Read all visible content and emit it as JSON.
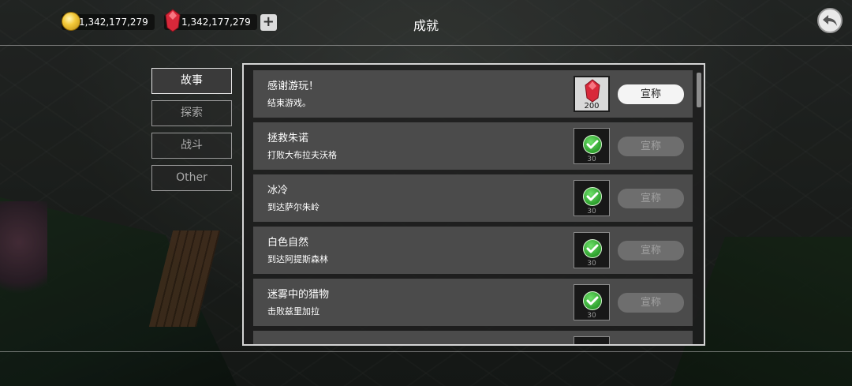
{
  "header": {
    "title": "成就",
    "gold_amount": "1,342,177,279",
    "gem_amount": "1,342,177,279",
    "add_symbol": "+"
  },
  "tabs": [
    {
      "label": "故事",
      "active": true
    },
    {
      "label": "探索",
      "active": false
    },
    {
      "label": "战斗",
      "active": false
    },
    {
      "label": "Other",
      "active": false
    }
  ],
  "achievements": [
    {
      "name": "感谢游玩！",
      "desc": "结束游戏。",
      "reward_qty": "200",
      "reward_icon": "gem-icon",
      "claim_label": "宣称",
      "claimable": true
    },
    {
      "name": "拯救朱诺",
      "desc": "打败大布拉夫沃格",
      "reward_qty": "30",
      "reward_icon": "check-icon",
      "claim_label": "宣称",
      "claimable": false
    },
    {
      "name": "冰冷",
      "desc": "到达萨尔朱岭",
      "reward_qty": "30",
      "reward_icon": "check-icon",
      "claim_label": "宣称",
      "claimable": false
    },
    {
      "name": "白色自然",
      "desc": "到达阿提斯森林",
      "reward_qty": "30",
      "reward_icon": "check-icon",
      "claim_label": "宣称",
      "claimable": false
    },
    {
      "name": "迷雾中的猎物",
      "desc": "击败兹里加拉",
      "reward_qty": "30",
      "reward_icon": "check-icon",
      "claim_label": "宣称",
      "claimable": false
    }
  ],
  "colors": {
    "active_claim": "#f4f4f4",
    "disabled_claim": "#6e6e6e",
    "check_green": "#2c9e2c",
    "gem_red": "#d8283a",
    "coin_gold": "#f3c93a"
  }
}
